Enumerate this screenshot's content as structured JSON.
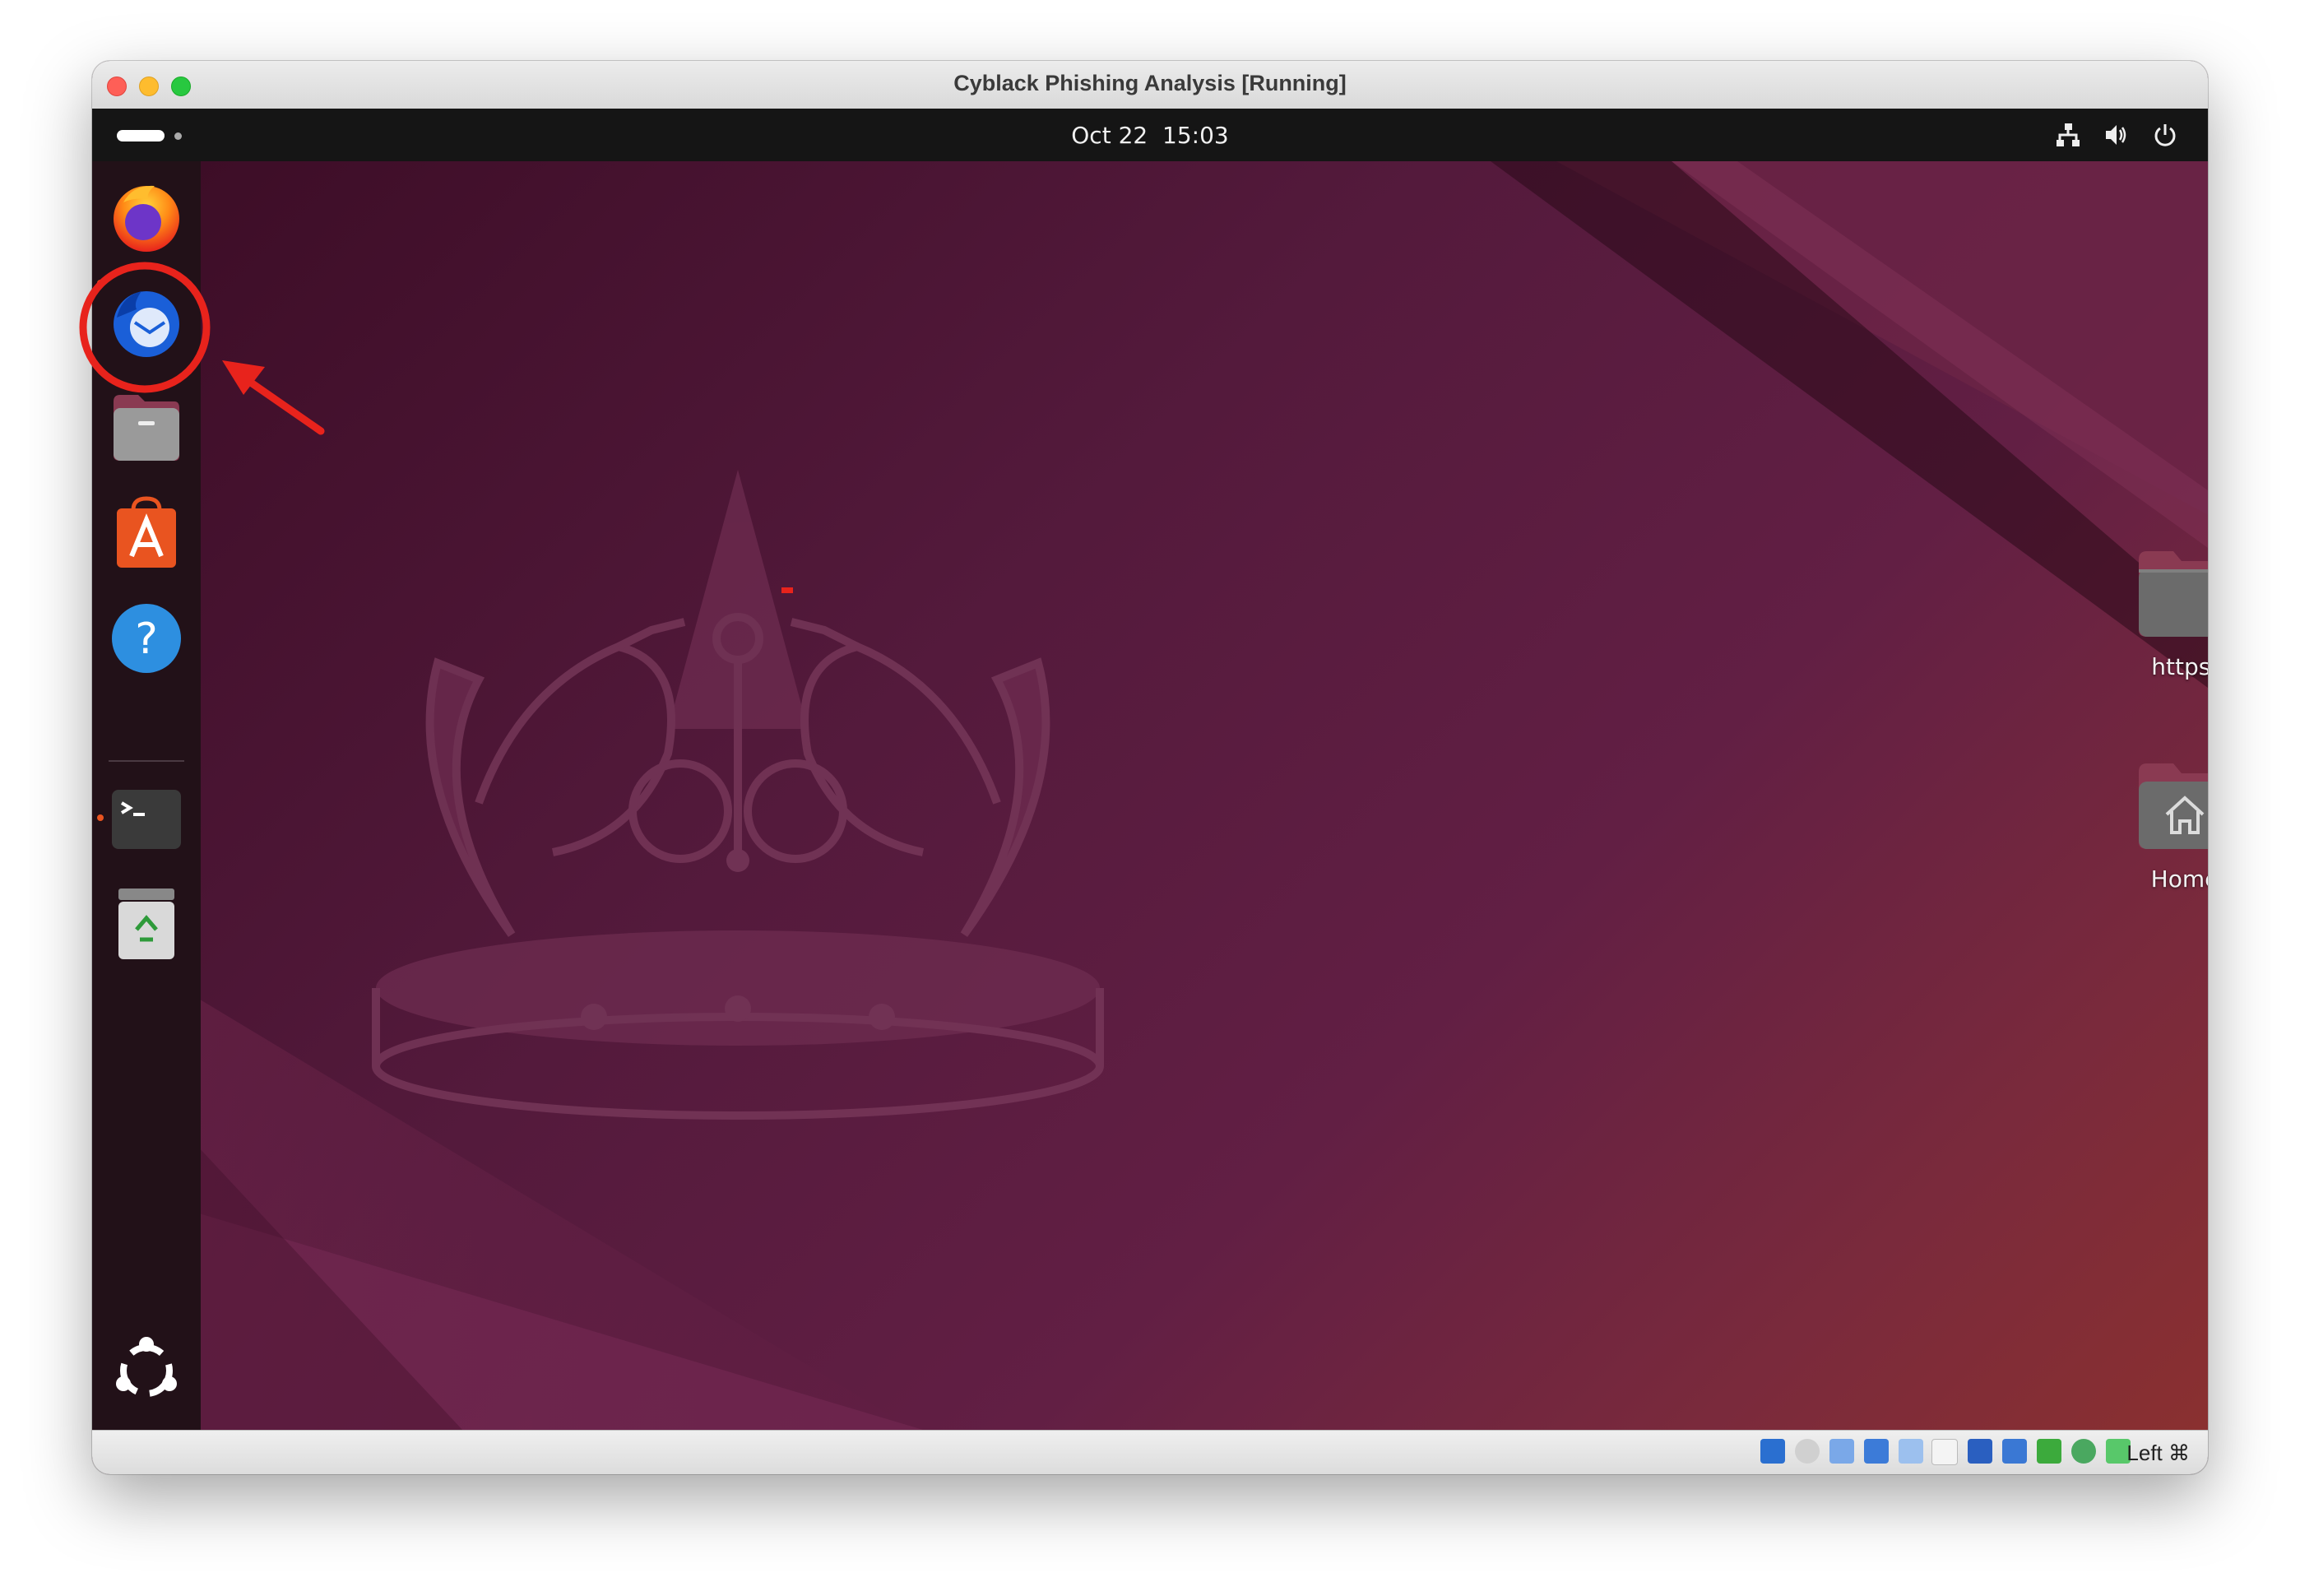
{
  "window": {
    "title": "Cyblack Phishing Analysis [Running]"
  },
  "topbar": {
    "date": "Oct 22",
    "time": "15:03",
    "tray_icons": [
      "network-icon",
      "volume-icon",
      "power-icon"
    ]
  },
  "dock": {
    "items": [
      {
        "name": "firefox",
        "icon": "firefox-icon",
        "running": true
      },
      {
        "name": "thunderbird",
        "icon": "thunderbird-icon",
        "running": false,
        "highlighted": true
      },
      {
        "name": "files",
        "icon": "files-icon",
        "running": false
      },
      {
        "name": "app-center",
        "icon": "app-center-icon",
        "running": false
      },
      {
        "name": "help",
        "icon": "help-icon",
        "running": false
      },
      {
        "name": "terminal",
        "icon": "terminal-icon",
        "running": true
      },
      {
        "name": "trash",
        "icon": "trash-icon",
        "running": false
      }
    ],
    "show_apps_icon": "ubuntu-logo-icon"
  },
  "desktop": {
    "icons": [
      {
        "label": "https:",
        "icon": "folder-icon"
      },
      {
        "label": "Home",
        "icon": "home-folder-icon"
      }
    ]
  },
  "statusbar": {
    "host_key": "Left ⌘"
  },
  "colors": {
    "annotation": "#e8231c",
    "accent": "#e95420",
    "desktop_base": "#541a3c"
  }
}
